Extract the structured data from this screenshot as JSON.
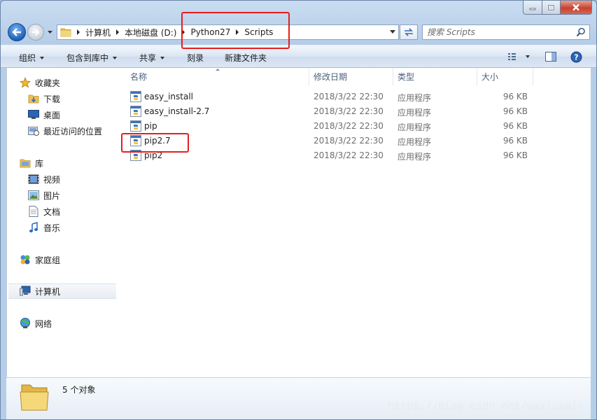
{
  "window": {
    "colors": {
      "frame": "#b6cde8",
      "close": "#c7432f",
      "highlight": "#e51e1e",
      "text_gray": "#6d6d6d",
      "header_text": "#4c607a"
    },
    "controls": [
      "minimize-icon",
      "maximize-icon",
      "close-icon"
    ]
  },
  "address_bar": {
    "crumbs": [
      "计算机",
      "本地磁盘 (D:)",
      "Python27",
      "Scripts"
    ]
  },
  "search": {
    "placeholder": "搜索 Scripts"
  },
  "toolbar": {
    "organize": "组织",
    "include_library": "包含到库中",
    "share": "共享",
    "burn": "刻录",
    "new_folder": "新建文件夹"
  },
  "sidebar": {
    "favorites": {
      "label": "收藏夹",
      "items": [
        "下载",
        "桌面",
        "最近访问的位置"
      ]
    },
    "libraries": {
      "label": "库",
      "items": [
        "视频",
        "图片",
        "文档",
        "音乐"
      ]
    },
    "homegroup": "家庭组",
    "computer": "计算机",
    "network": "网络"
  },
  "columns": {
    "name": "名称",
    "date": "修改日期",
    "type": "类型",
    "size": "大小"
  },
  "files": [
    {
      "name": "easy_install",
      "date": "2018/3/22 22:30",
      "type": "应用程序",
      "size": "96 KB"
    },
    {
      "name": "easy_install-2.7",
      "date": "2018/3/22 22:30",
      "type": "应用程序",
      "size": "96 KB"
    },
    {
      "name": "pip",
      "date": "2018/3/22 22:30",
      "type": "应用程序",
      "size": "96 KB"
    },
    {
      "name": "pip2.7",
      "date": "2018/3/22 22:30",
      "type": "应用程序",
      "size": "96 KB"
    },
    {
      "name": "pip2",
      "date": "2018/3/22 22:30",
      "type": "应用程序",
      "size": "96 KB"
    }
  ],
  "details": {
    "count": "5 个对象"
  },
  "watermark": "https://blog.csdn.net/maxjuxain"
}
